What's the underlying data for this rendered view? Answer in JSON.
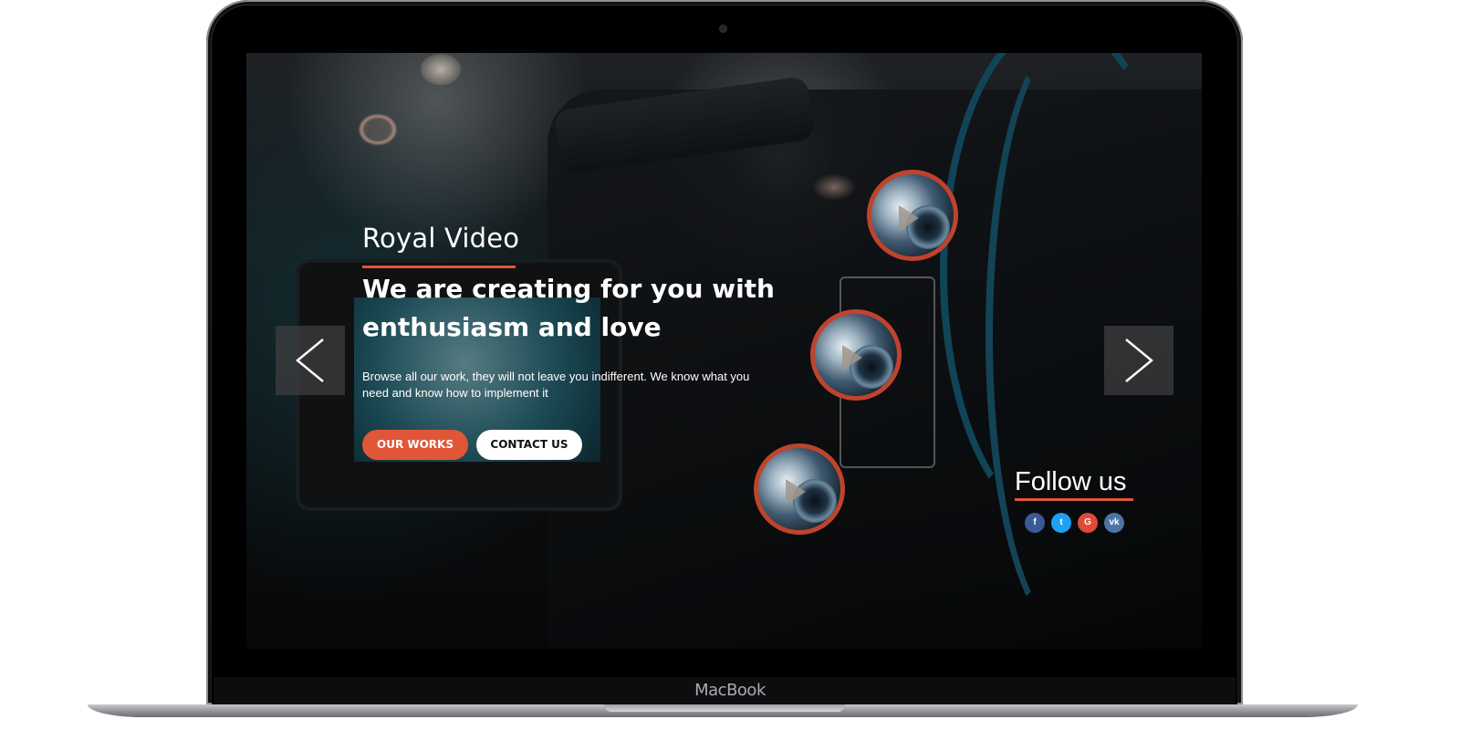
{
  "device": {
    "brand_label": "MacBook"
  },
  "hero": {
    "brand": "Royal Video",
    "headline": "We are creating for you with enthusiasm and love",
    "body": "Browse all our work, they will not leave you indifferent. We know what you need and know how to implement it",
    "buttons": {
      "primary": "OUR WORKS",
      "secondary": "CONTACT US"
    }
  },
  "slider": {
    "prev_icon": "chevron-left-icon",
    "next_icon": "chevron-right-icon"
  },
  "thumbnails": [
    {
      "icon": "play-icon"
    },
    {
      "icon": "play-icon"
    },
    {
      "icon": "play-icon"
    }
  ],
  "follow": {
    "title": "Follow us",
    "networks": [
      {
        "name": "facebook-icon",
        "glyph": "f",
        "color": "#3b5998"
      },
      {
        "name": "twitter-icon",
        "glyph": "t",
        "color": "#1da1f2"
      },
      {
        "name": "google-plus-icon",
        "glyph": "G",
        "color": "#dd4b39"
      },
      {
        "name": "vk-icon",
        "glyph": "vk",
        "color": "#4c75a3"
      }
    ]
  },
  "colors": {
    "accent": "#e05637",
    "thumb_ring": "#c0432e"
  }
}
